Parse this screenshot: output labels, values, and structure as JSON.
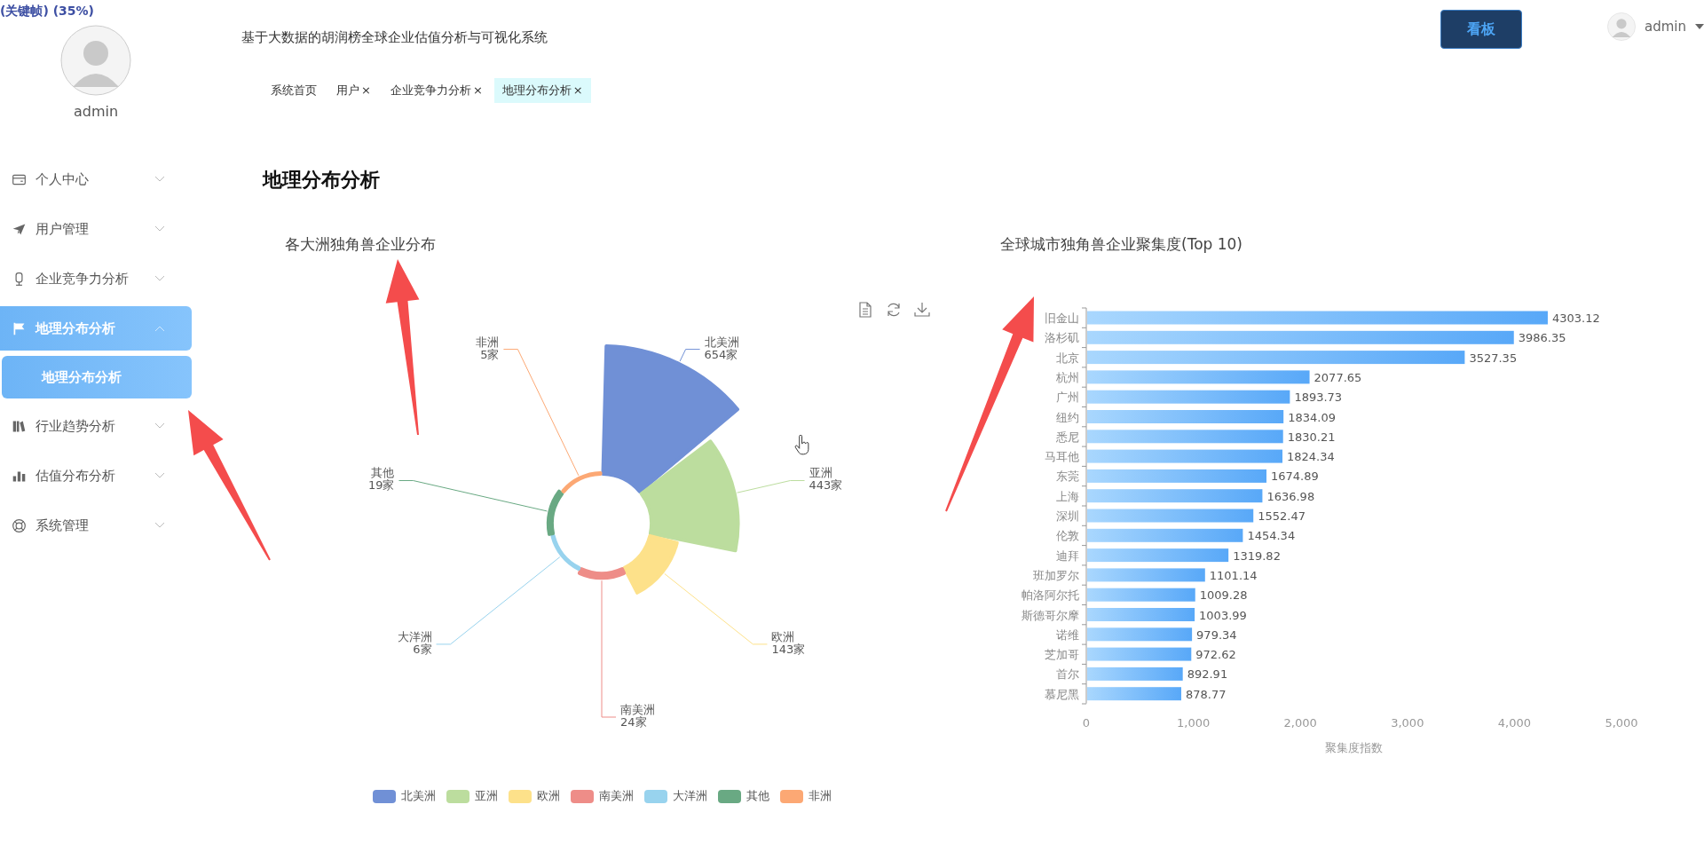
{
  "recorder_overlay": "(关键帧) (35%)",
  "sidebar": {
    "user": "admin",
    "menu": [
      {
        "label": "个人中心",
        "expanded": false,
        "selected": false
      },
      {
        "label": "用户管理",
        "expanded": false,
        "selected": false
      },
      {
        "label": "企业竞争力分析",
        "expanded": false,
        "selected": false
      },
      {
        "label": "地理分布分析",
        "expanded": true,
        "selected": true,
        "children": [
          {
            "label": "地理分布分析",
            "selected": true
          }
        ]
      },
      {
        "label": "行业趋势分析",
        "expanded": false,
        "selected": false
      },
      {
        "label": "估值分布分析",
        "expanded": false,
        "selected": false
      },
      {
        "label": "系统管理",
        "expanded": false,
        "selected": false
      }
    ]
  },
  "header": {
    "title": "基于大数据的胡润榜全球企业估值分析与可视化系统",
    "dashboard_button": "看板",
    "user": "admin"
  },
  "tabs": [
    {
      "label": "系统首页",
      "selected": false
    },
    {
      "label": "用户",
      "close": "×",
      "selected": false
    },
    {
      "label": "企业竞争力分析",
      "close": "×",
      "selected": false
    },
    {
      "label": "地理分布分析",
      "close": "×",
      "selected": true
    }
  ],
  "page_title": "地理分布分析",
  "continent_chart": {
    "chart_data": {
      "type": "other",
      "title": "各大洲独角兽企业分布",
      "categories": [
        "北美洲",
        "亚洲",
        "欧洲",
        "南美洲",
        "大洋洲",
        "其他",
        "非洲"
      ],
      "values": [
        654,
        443,
        143,
        24,
        6,
        19,
        5
      ],
      "value_labels": [
        "654家",
        "443家",
        "143家",
        "24家",
        "6家",
        "19家",
        "5家"
      ]
    },
    "legend": [
      {
        "label": "北美洲",
        "color": "#7090d6"
      },
      {
        "label": "亚洲",
        "color": "#bcdd9e"
      },
      {
        "label": "欧洲",
        "color": "#fde18a"
      },
      {
        "label": "南美洲",
        "color": "#ee8d88"
      },
      {
        "label": "大洋洲",
        "color": "#98d3ee"
      },
      {
        "label": "其他",
        "color": "#69a983"
      },
      {
        "label": "非洲",
        "color": "#fca874"
      }
    ]
  },
  "city_chart": {
    "chart_data": {
      "type": "bar",
      "orientation": "horizontal",
      "title": "全球城市独角兽企业聚集度(Top 10)",
      "xlabel": "聚集度指数",
      "categories": [
        "旧金山",
        "洛杉矶",
        "北京",
        "杭州",
        "广州",
        "纽约",
        "悉尼",
        "马耳他",
        "东莞",
        "上海",
        "深圳",
        "伦敦",
        "迪拜",
        "班加罗尔",
        "帕洛阿尔托",
        "斯德哥尔摩",
        "诺维",
        "芝加哥",
        "首尔",
        "慕尼黑"
      ],
      "series": [
        {
          "color": "#58a8f8",
          "values": [
            4303.12,
            3986.35,
            3527.35,
            2077.65,
            1893.73,
            1834.09,
            1830.21,
            1824.34,
            1674.89,
            1636.98,
            1552.47,
            1454.34,
            1319.82,
            1101.14,
            1009.28,
            1003.99,
            979.34,
            972.62,
            892.91,
            878.77
          ]
        }
      ],
      "xlim": [
        0,
        5000
      ],
      "xticks": [
        {
          "value": 0,
          "label": "0"
        },
        {
          "value": 1000,
          "label": "1,000"
        },
        {
          "value": 2000,
          "label": "2,000"
        },
        {
          "value": 3000,
          "label": "3,000"
        },
        {
          "value": 4000,
          "label": "4,000"
        },
        {
          "value": 5000,
          "label": "5,000"
        }
      ],
      "data_labels": true
    }
  }
}
